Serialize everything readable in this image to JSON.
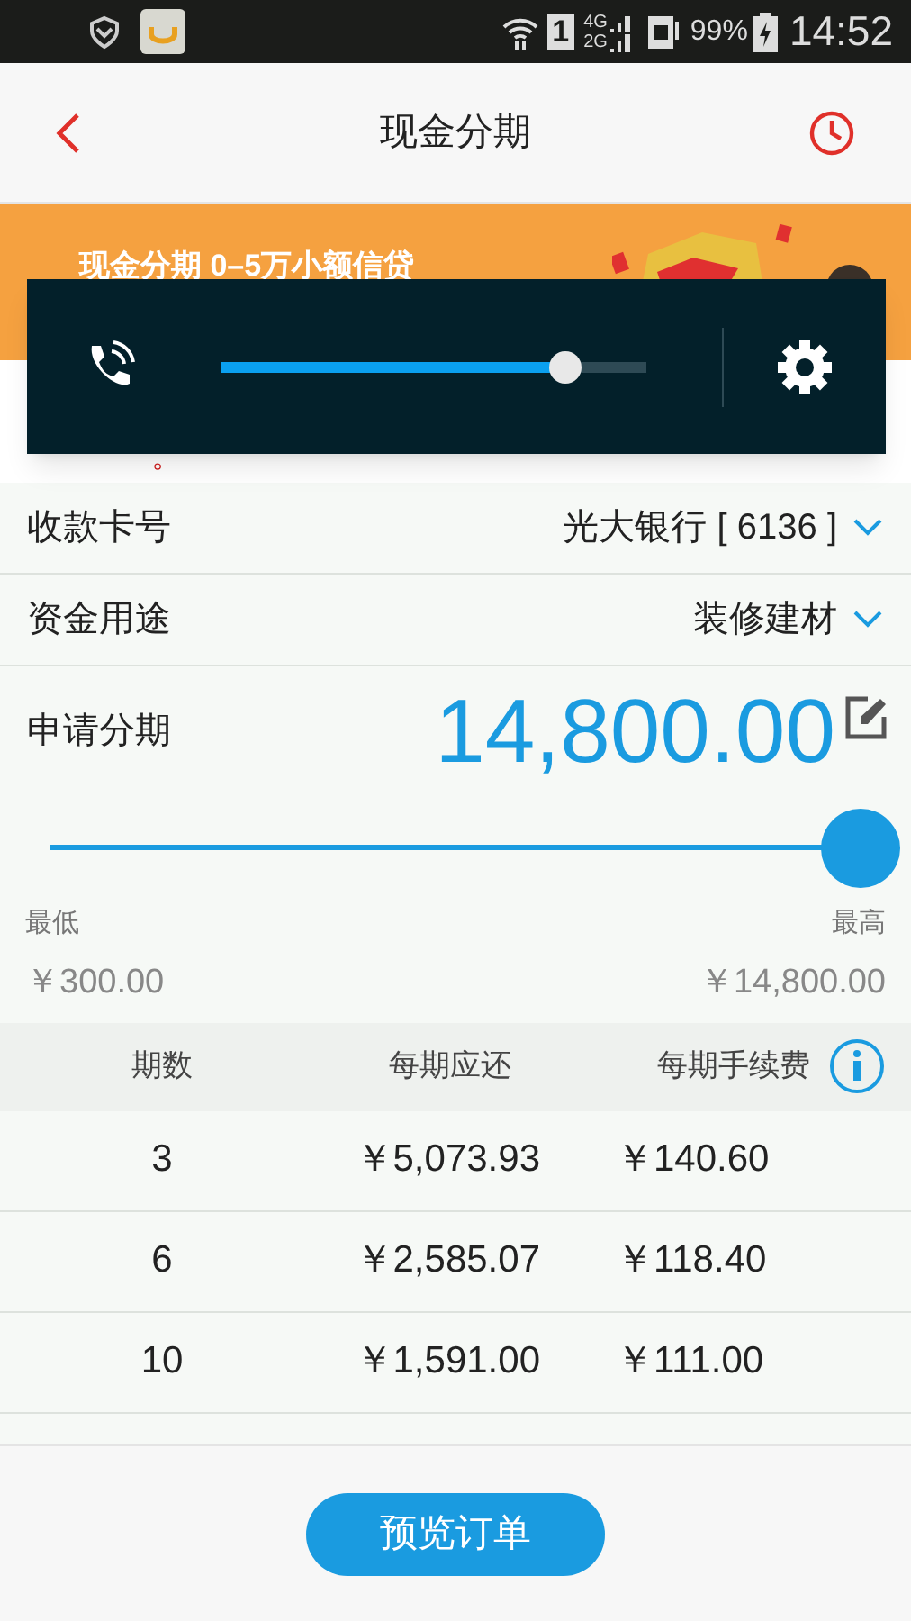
{
  "status_bar": {
    "sim": "1",
    "network_1": "4G",
    "network_2": "2G",
    "battery": "99%",
    "time": "14:52"
  },
  "header": {
    "title": "现金分期"
  },
  "banner": {
    "text": "现金分期 0–5万小额信贷"
  },
  "notice": "。",
  "volume_overlay": {
    "level": 0.81
  },
  "fields": [
    {
      "label": "收款卡号",
      "value": "光大银行 [ 6136 ]"
    },
    {
      "label": "资金用途",
      "value": "装修建材"
    }
  ],
  "amount": {
    "label": "申请分期",
    "value": "14,800.00"
  },
  "amount_slider": {
    "level": 1
  },
  "range": {
    "min_label": "最低",
    "min": "￥300.00",
    "max_label": "最高",
    "max": "￥14,800.00"
  },
  "table": {
    "columns": [
      "期数",
      "每期应还",
      "每期手续费"
    ],
    "rows": [
      [
        "3",
        "￥5,073.93",
        "￥140.60"
      ],
      [
        "6",
        "￥2,585.07",
        "￥118.40"
      ],
      [
        "10",
        "￥1,591.00",
        "￥111.00"
      ]
    ]
  },
  "button": "预览订单"
}
